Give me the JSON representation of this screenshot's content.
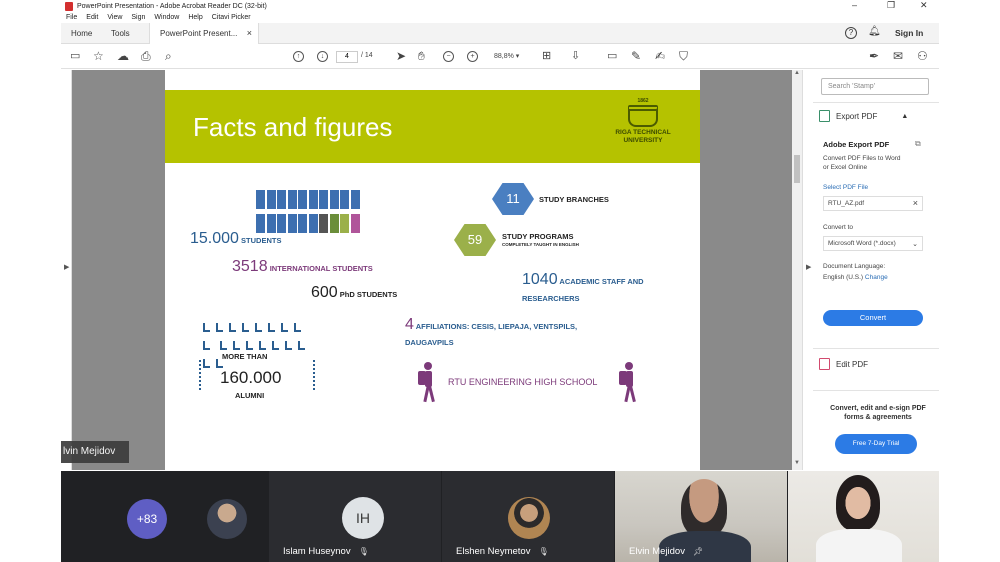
{
  "window": {
    "title": "PowerPoint Presentation - Adobe Acrobat Reader DC (32-bit)",
    "menu": [
      "File",
      "Edit",
      "View",
      "Sign",
      "Window",
      "Help",
      "Citavi Picker"
    ]
  },
  "tabs": {
    "home": "Home",
    "tools": "Tools",
    "doc": "PowerPoint Present...",
    "close": "×",
    "help": "?",
    "signin": "Sign In"
  },
  "toolbar": {
    "page_current": "4",
    "page_total": "/ 14",
    "zoom": "88,8%"
  },
  "slide": {
    "title": "Facts and figures",
    "logo_year": "1862",
    "logo_name_1": "RIGA TECHNICAL",
    "logo_name_2": "UNIVERSITY",
    "students_num": "15.000",
    "students_label": "STUDENTS",
    "intl_num": "3518",
    "intl_label": "INTERNATIONAL STUDENTS",
    "phd_num": "600",
    "phd_label": "PhD STUDENTS",
    "branches_num": "11",
    "branches_label": "STUDY BRANCHES",
    "programs_num": "59",
    "programs_label": "STUDY PROGRAMS",
    "programs_sub": "COMPLETELY TAUGHT IN ENGLISH",
    "staff_num": "1040",
    "staff_label_1": "ACADEMIC STAFF AND",
    "staff_label_2": "RESEARCHERS",
    "affil_num": "4",
    "affil_label_1": "AFFILIATIONS: CESIS, LIEPAJA, VENTSPILS,",
    "affil_label_2": "DAUGAVPILS",
    "alumni_more": "MORE THAN",
    "alumni_num": "160.000",
    "alumni_label": "ALUMNI",
    "school": "RTU ENGINEERING HIGH SCHOOL",
    "colors": {
      "header": "#b5c200",
      "blue": "#2a5d8f",
      "purple": "#7c3a7a",
      "hex_blue": "#4a7fc1",
      "hex_green": "#9bb04a"
    }
  },
  "panel": {
    "search_placeholder": "Search 'Stamp'",
    "export_pdf": "Export PDF",
    "export_title": "Adobe Export PDF",
    "export_desc_1": "Convert PDF Files to Word",
    "export_desc_2": "or Excel Online",
    "select_label": "Select PDF File",
    "file_name": "RTU_AZ.pdf",
    "convert_to": "Convert to",
    "convert_format": "Microsoft Word (*.docx)",
    "doc_lang": "Document Language:",
    "lang_value": "English (U.S.)",
    "change": "Change",
    "convert_btn": "Convert",
    "edit_pdf": "Edit PDF",
    "promo_1": "Convert, edit and e-sign PDF",
    "promo_2": "forms & agreements",
    "trial_btn": "Free 7-Day Trial"
  },
  "meeting": {
    "speaker": "lvin Mejidov",
    "more_count": "+83",
    "p2_initials": "IH",
    "p2_name": "Islam Huseynov",
    "p3_name": "Elshen Neymetov",
    "p4_name": "Elvin Mejidov"
  }
}
